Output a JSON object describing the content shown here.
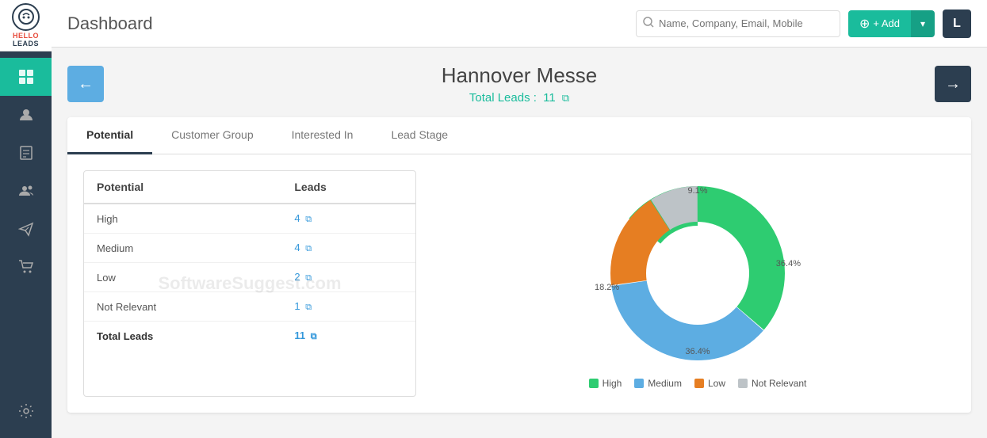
{
  "sidebar": {
    "logo": {
      "line1": "HELLO",
      "line2": "LEADS"
    },
    "items": [
      {
        "name": "dashboard",
        "icon": "⊞",
        "active": true
      },
      {
        "name": "contacts",
        "icon": "👥",
        "active": false
      },
      {
        "name": "reports",
        "icon": "📋",
        "active": false
      },
      {
        "name": "users",
        "icon": "👤",
        "active": false
      },
      {
        "name": "send",
        "icon": "✉",
        "active": false
      },
      {
        "name": "cart",
        "icon": "🛒",
        "active": false
      },
      {
        "name": "settings",
        "icon": "🔧",
        "active": false
      }
    ]
  },
  "header": {
    "title": "Dashboard",
    "search_placeholder": "Name, Company, Email, Mobile",
    "add_button": "+ Add",
    "user_initial": "L"
  },
  "event": {
    "title": "Hannover Messe",
    "total_label": "Total Leads :",
    "total_count": "11",
    "nav_left": "←",
    "nav_right": "→"
  },
  "tabs": [
    {
      "id": "potential",
      "label": "Potential",
      "active": true
    },
    {
      "id": "customer-group",
      "label": "Customer Group",
      "active": false
    },
    {
      "id": "interested-in",
      "label": "Interested In",
      "active": false
    },
    {
      "id": "lead-stage",
      "label": "Lead Stage",
      "active": false
    }
  ],
  "table": {
    "col1_header": "Potential",
    "col2_header": "Leads",
    "rows": [
      {
        "label": "High",
        "value": "4"
      },
      {
        "label": "Medium",
        "value": "4"
      },
      {
        "label": "Low",
        "value": "2"
      },
      {
        "label": "Not Relevant",
        "value": "1"
      }
    ],
    "total_label": "Total Leads",
    "total_value": "11"
  },
  "chart": {
    "segments": [
      {
        "label": "High",
        "percent": 36.4,
        "color": "#2ecc71",
        "startAngle": 0
      },
      {
        "label": "Medium",
        "percent": 36.4,
        "color": "#5dade2",
        "startAngle": 130.9
      },
      {
        "label": "Low",
        "percent": 18.2,
        "color": "#e67e22",
        "startAngle": 261.8
      },
      {
        "label": "Not Relevant",
        "percent": 9.1,
        "color": "#bdc3c7",
        "startAngle": 327.3
      }
    ],
    "labels": {
      "top_right": "9.1%",
      "right": "36.4%",
      "bottom": "36.4%",
      "left": "18.2%"
    },
    "legend": [
      {
        "label": "High",
        "color": "#2ecc71"
      },
      {
        "label": "Medium",
        "color": "#5dade2"
      },
      {
        "label": "Low",
        "color": "#e67e22"
      },
      {
        "label": "Not Relevant",
        "color": "#bdc3c7"
      }
    ]
  }
}
